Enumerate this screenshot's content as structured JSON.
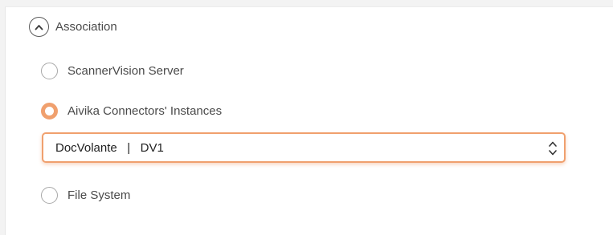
{
  "section": {
    "title": "Association"
  },
  "options": [
    {
      "label": "ScannerVision Server",
      "checked": false
    },
    {
      "label": "Aivika Connectors' Instances",
      "checked": true
    },
    {
      "label": "File System",
      "checked": false
    }
  ],
  "instance_select": {
    "value": "DocVolante   |   DV1"
  },
  "colors": {
    "accent": "#f0a06e",
    "text": "#4a4a4a"
  }
}
